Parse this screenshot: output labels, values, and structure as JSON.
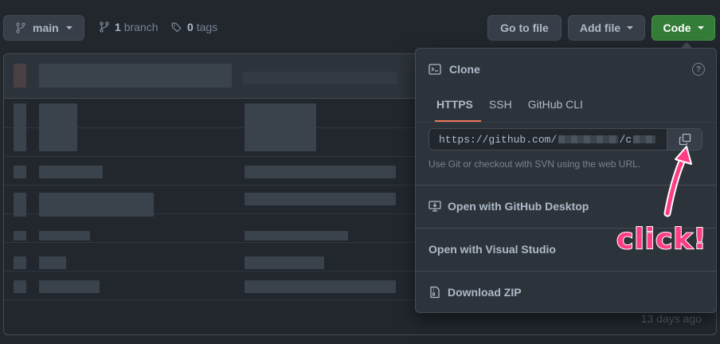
{
  "toolbar": {
    "branch_name": "main",
    "branch_count": "1",
    "branch_label": "branch",
    "tag_count": "0",
    "tag_label": "tags",
    "go_to_file": "Go to file",
    "add_file": "Add file",
    "code": "Code"
  },
  "repo": {
    "last_updated": "13 days ago"
  },
  "clone": {
    "title": "Clone",
    "tabs": [
      {
        "label": "HTTPS",
        "active": true
      },
      {
        "label": "SSH",
        "active": false
      },
      {
        "label": "GitHub CLI",
        "active": false
      }
    ],
    "url_prefix": "https://github.com/",
    "url_suffix": "/c",
    "hint": "Use Git or checkout with SVN using the web URL.",
    "actions": {
      "desktop": "Open with GitHub Desktop",
      "visual_studio": "Open with Visual Studio",
      "zip": "Download ZIP"
    }
  },
  "annotation": {
    "text": "click!",
    "color": "#ff3d84"
  },
  "colors": {
    "background": "#22272e",
    "panel": "#2d333b",
    "border": "#444c56",
    "primary_button": "#347d39",
    "tab_underline": "#ec775c"
  }
}
